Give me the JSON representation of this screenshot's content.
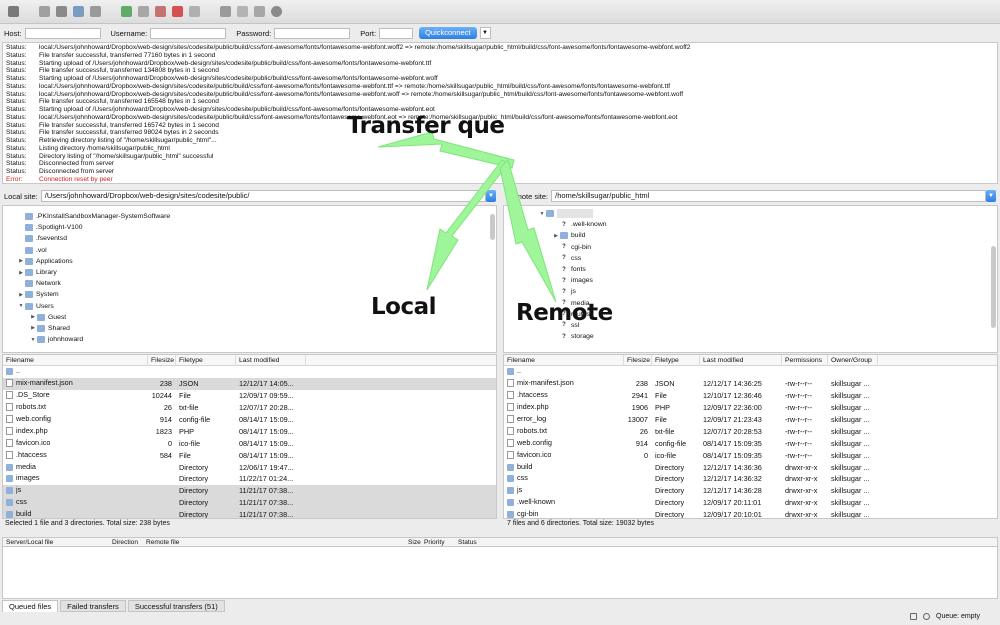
{
  "quickconnect": {
    "host_label": "Host:",
    "username_label": "Username:",
    "password_label": "Password:",
    "port_label": "Port:",
    "button_label": "Quickconnect"
  },
  "log": [
    {
      "kind": "Status:",
      "text": "local:/Users/johnhoward/Dropbox/web-design/sites/codesite/public/build/css/font-awesome/fonts/fontawesome-webfont.woff2 => remote:/home/skillsugar/public_html/build/css/font-awesome/fonts/fontawesome-webfont.woff2"
    },
    {
      "kind": "Status:",
      "text": "File transfer successful, transferred 77160 bytes in 1 second"
    },
    {
      "kind": "Status:",
      "text": "Starting upload of /Users/johnhoward/Dropbox/web-design/sites/codesite/public/build/css/font-awesome/fonts/fontawesome-webfont.ttf"
    },
    {
      "kind": "Status:",
      "text": "File transfer successful, transferred 134808 bytes in 1 second"
    },
    {
      "kind": "Status:",
      "text": "Starting upload of /Users/johnhoward/Dropbox/web-design/sites/codesite/public/build/css/font-awesome/fonts/fontawesome-webfont.woff"
    },
    {
      "kind": "Status:",
      "text": "local:/Users/johnhoward/Dropbox/web-design/sites/codesite/public/build/css/font-awesome/fonts/fontawesome-webfont.ttf => remote:/home/skillsugar/public_html/build/css/font-awesome/fonts/fontawesome-webfont.ttf"
    },
    {
      "kind": "Status:",
      "text": "local:/Users/johnhoward/Dropbox/web-design/sites/codesite/public/build/css/font-awesome/fonts/fontawesome-webfont.woff => remote:/home/skillsugar/public_html/build/css/font-awesome/fonts/fontawesome-webfont.woff"
    },
    {
      "kind": "Status:",
      "text": "File transfer successful, transferred 165548 bytes in 1 second"
    },
    {
      "kind": "Status:",
      "text": "Starting upload of /Users/johnhoward/Dropbox/web-design/sites/codesite/public/build/css/font-awesome/fonts/fontawesome-webfont.eot"
    },
    {
      "kind": "Status:",
      "text": "local:/Users/johnhoward/Dropbox/web-design/sites/codesite/public/build/css/font-awesome/fonts/fontawesome-webfont.eot => remote:/home/skillsugar/public_html/build/css/font-awesome/fonts/fontawesome-webfont.eot"
    },
    {
      "kind": "Status:",
      "text": "File transfer successful, transferred 165742 bytes in 1 second"
    },
    {
      "kind": "Status:",
      "text": "File transfer successful, transferred 98024 bytes in 2 seconds"
    },
    {
      "kind": "Status:",
      "text": "Retrieving directory listing of \"/home/skillsugar/public_html\"..."
    },
    {
      "kind": "Status:",
      "text": "Listing directory /home/skillsugar/public_html"
    },
    {
      "kind": "Status:",
      "text": "Directory listing of \"/home/skillsugar/public_html\" successful"
    },
    {
      "kind": "Status:",
      "text": "Disconnected from server"
    },
    {
      "kind": "Status:",
      "text": "Disconnected from server"
    },
    {
      "kind": "Error:",
      "text": "Connection reset by peer",
      "error": true
    }
  ],
  "local_site": {
    "label": "Local site:",
    "path": "/Users/johnhoward/Dropbox/web-design/sites/codesite/public/"
  },
  "remote_site": {
    "label": "Remote site:",
    "path": "/home/skillsugar/public_html"
  },
  "local_tree": [
    {
      "label": ".PKInstallSandboxManager-SystemSoftware",
      "depth": 2,
      "twisty": ""
    },
    {
      "label": ".Spotlight-V100",
      "depth": 2,
      "twisty": ""
    },
    {
      "label": ".fseventsd",
      "depth": 2,
      "twisty": ""
    },
    {
      "label": ".vol",
      "depth": 2,
      "twisty": ""
    },
    {
      "label": "Applications",
      "depth": 2,
      "twisty": "▶"
    },
    {
      "label": "Library",
      "depth": 2,
      "twisty": "▶"
    },
    {
      "label": "Network",
      "depth": 2,
      "twisty": ""
    },
    {
      "label": "System",
      "depth": 2,
      "twisty": "▶"
    },
    {
      "label": "Users",
      "depth": 2,
      "twisty": "▼"
    },
    {
      "label": "Guest",
      "depth": 3,
      "twisty": "▶"
    },
    {
      "label": "Shared",
      "depth": 3,
      "twisty": "▶"
    },
    {
      "label": "johnhoward",
      "depth": 3,
      "twisty": "▼"
    }
  ],
  "remote_tree": [
    {
      "label": ".well-known",
      "icon": "q"
    },
    {
      "label": "build",
      "icon": "folder"
    },
    {
      "label": "cgi-bin",
      "icon": "q"
    },
    {
      "label": "css",
      "icon": "q"
    },
    {
      "label": "fonts",
      "icon": "q"
    },
    {
      "label": "images",
      "icon": "q"
    },
    {
      "label": "js",
      "icon": "q"
    },
    {
      "label": "media",
      "icon": "q"
    },
    {
      "label": "routes",
      "icon": "q"
    },
    {
      "label": "ssl",
      "icon": "q"
    },
    {
      "label": "storage",
      "icon": "q"
    }
  ],
  "local_columns": [
    "Filename",
    "Filesize",
    "Filetype",
    "Last modified"
  ],
  "remote_columns": [
    "Filename",
    "Filesize",
    "Filetype",
    "Last modified",
    "Permissions",
    "Owner/Group"
  ],
  "local_files": [
    {
      "name": "..",
      "size": "",
      "type": "",
      "modified": "",
      "kind": "dir"
    },
    {
      "name": "mix-manifest.json",
      "size": "238",
      "type": "JSON",
      "modified": "12/12/17 14:05...",
      "kind": "file",
      "selected": true
    },
    {
      "name": ".DS_Store",
      "size": "10244",
      "type": "File",
      "modified": "12/09/17 09:59...",
      "kind": "file"
    },
    {
      "name": "robots.txt",
      "size": "26",
      "type": "txt-file",
      "modified": "12/07/17 20:28...",
      "kind": "file"
    },
    {
      "name": "web.config",
      "size": "914",
      "type": "config-file",
      "modified": "08/14/17 15:09...",
      "kind": "file"
    },
    {
      "name": "index.php",
      "size": "1823",
      "type": "PHP",
      "modified": "08/14/17 15:09...",
      "kind": "file"
    },
    {
      "name": "favicon.ico",
      "size": "0",
      "type": "ico-file",
      "modified": "08/14/17 15:09...",
      "kind": "file"
    },
    {
      "name": ".htaccess",
      "size": "584",
      "type": "File",
      "modified": "08/14/17 15:09...",
      "kind": "file"
    },
    {
      "name": "media",
      "size": "",
      "type": "Directory",
      "modified": "12/06/17 19:47...",
      "kind": "dir"
    },
    {
      "name": "images",
      "size": "",
      "type": "Directory",
      "modified": "11/22/17 01:24...",
      "kind": "dir"
    },
    {
      "name": "js",
      "size": "",
      "type": "Directory",
      "modified": "11/21/17 07:38...",
      "kind": "dir",
      "selected": true
    },
    {
      "name": "css",
      "size": "",
      "type": "Directory",
      "modified": "11/21/17 07:38...",
      "kind": "dir",
      "selected": true
    },
    {
      "name": "build",
      "size": "",
      "type": "Directory",
      "modified": "11/21/17 07:38...",
      "kind": "dir",
      "selected": true
    }
  ],
  "remote_files": [
    {
      "name": "..",
      "size": "",
      "type": "",
      "modified": "",
      "perms": "",
      "owner": "",
      "kind": "dir"
    },
    {
      "name": "mix-manifest.json",
      "size": "238",
      "type": "JSON",
      "modified": "12/12/17 14:36:25",
      "perms": "-rw-r--r--",
      "owner": "skillsugar ...",
      "kind": "file"
    },
    {
      "name": ".htaccess",
      "size": "2941",
      "type": "File",
      "modified": "12/10/17 12:36:46",
      "perms": "-rw-r--r--",
      "owner": "skillsugar ...",
      "kind": "file"
    },
    {
      "name": "index.php",
      "size": "1906",
      "type": "PHP",
      "modified": "12/09/17 22:36:00",
      "perms": "-rw-r--r--",
      "owner": "skillsugar ...",
      "kind": "file"
    },
    {
      "name": "error_log",
      "size": "13007",
      "type": "File",
      "modified": "12/09/17 21:23:43",
      "perms": "-rw-r--r--",
      "owner": "skillsugar ...",
      "kind": "file"
    },
    {
      "name": "robots.txt",
      "size": "26",
      "type": "txt-file",
      "modified": "12/07/17 20:28:53",
      "perms": "-rw-r--r--",
      "owner": "skillsugar ...",
      "kind": "file"
    },
    {
      "name": "web.config",
      "size": "914",
      "type": "config-file",
      "modified": "08/14/17 15:09:35",
      "perms": "-rw-r--r--",
      "owner": "skillsugar ...",
      "kind": "file"
    },
    {
      "name": "favicon.ico",
      "size": "0",
      "type": "ico-file",
      "modified": "08/14/17 15:09:35",
      "perms": "-rw-r--r--",
      "owner": "skillsugar ...",
      "kind": "file"
    },
    {
      "name": "build",
      "size": "",
      "type": "Directory",
      "modified": "12/12/17 14:36:36",
      "perms": "drwxr-xr-x",
      "owner": "skillsugar ...",
      "kind": "dir"
    },
    {
      "name": "css",
      "size": "",
      "type": "Directory",
      "modified": "12/12/17 14:36:32",
      "perms": "drwxr-xr-x",
      "owner": "skillsugar ...",
      "kind": "dir"
    },
    {
      "name": "js",
      "size": "",
      "type": "Directory",
      "modified": "12/12/17 14:36:28",
      "perms": "drwxr-xr-x",
      "owner": "skillsugar ...",
      "kind": "dir"
    },
    {
      "name": ".well-known",
      "size": "",
      "type": "Directory",
      "modified": "12/09/17 20:11:01",
      "perms": "drwxr-xr-x",
      "owner": "skillsugar ...",
      "kind": "dir"
    },
    {
      "name": "cgi-bin",
      "size": "",
      "type": "Directory",
      "modified": "12/09/17 20:10:01",
      "perms": "drwxr-xr-x",
      "owner": "skillsugar ...",
      "kind": "dir"
    }
  ],
  "local_status": "Selected 1 file and 3 directories. Total size: 238 bytes",
  "remote_status": "7 files and 6 directories. Total size: 19032 bytes",
  "queue_columns": [
    "Server/Local file",
    "Direction",
    "Remote file",
    "Size",
    "Priority",
    "Status"
  ],
  "queue_tabs": [
    "Queued files",
    "Failed transfers",
    "Successful transfers (51)"
  ],
  "queue_status": "Queue: empty",
  "annotations": {
    "transfer_queue": "Transfer que",
    "local": "Local",
    "remote": "Remote"
  },
  "colors": {
    "accent": "#3a8ee6",
    "arrow": "#9ef59a",
    "error": "#d21d1d"
  }
}
